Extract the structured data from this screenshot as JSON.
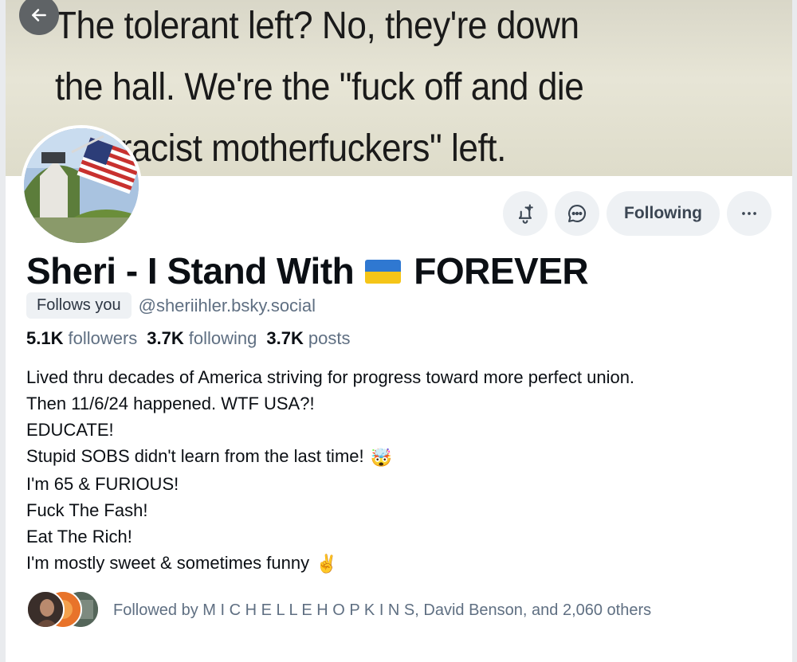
{
  "banner": {
    "text": "The tolerant left? No, they're down\nthe hall. We're the \"fuck off and die\nyou racist motherfuckers\" left."
  },
  "header": {
    "back_icon": "arrow-left-icon"
  },
  "actions": {
    "subscribe_icon": "bell-plus-icon",
    "message_icon": "chat-bubble-icon",
    "follow_label": "Following",
    "more_icon": "ellipsis-icon"
  },
  "profile": {
    "name_part1": "Sheri - I Stand With",
    "name_flag": "ukraine-flag",
    "name_part2": "FOREVER",
    "follows_you": "Follows you",
    "handle": "@sheriihler.bsky.social"
  },
  "stats": {
    "followers_count": "5.1K",
    "followers_label": "followers",
    "following_count": "3.7K",
    "following_label": "following",
    "posts_count": "3.7K",
    "posts_label": "posts"
  },
  "bio": {
    "lines": [
      "Lived thru decades of America striving for progress toward more perfect union.",
      "Then 11/6/24 happened. WTF USA?!",
      "EDUCATE!",
      "Stupid SOBS didn't learn from the last time!",
      "I'm 65 & FURIOUS!",
      "Fuck The Fash!",
      "Eat The Rich!",
      "I'm mostly sweet & sometimes funny"
    ],
    "emoji_line4": "🤯",
    "emoji_line8": "✌️"
  },
  "followed_by": {
    "text": "Followed by M I C H E L L E H O P K I N S, David Benson, and 2,060 others"
  },
  "colors": {
    "accent_text": "#5f6f82",
    "button_bg": "#eef1f4",
    "ukraine_blue": "#2f78d1",
    "ukraine_yellow": "#f5c518"
  }
}
